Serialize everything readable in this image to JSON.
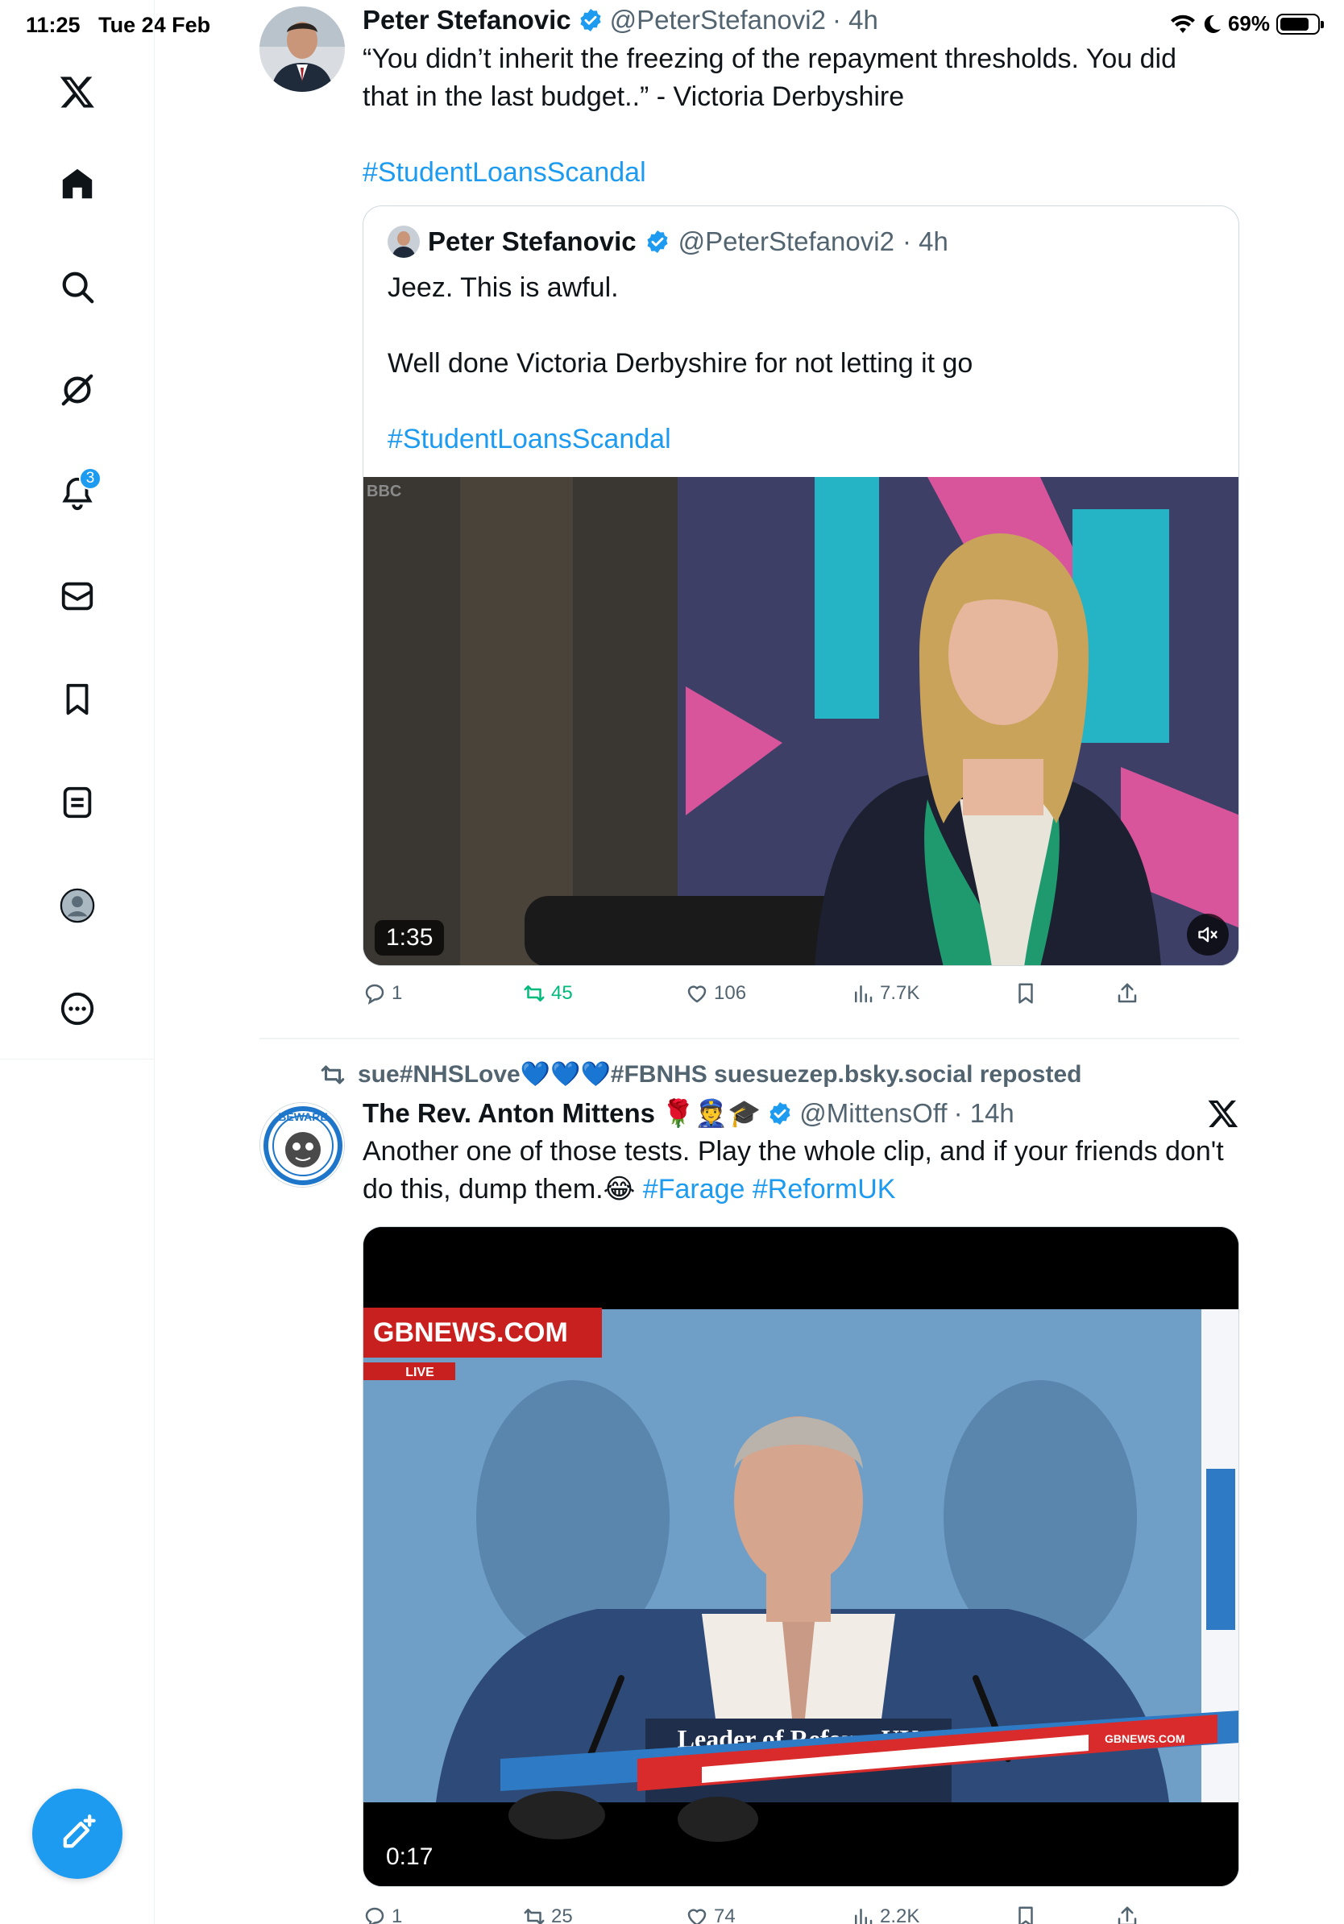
{
  "status_bar": {
    "time": "11:25",
    "date": "Tue 24 Feb",
    "battery": "69%"
  },
  "sidebar": {
    "items": [
      {
        "icon": "x-logo-icon"
      },
      {
        "icon": "home-icon"
      },
      {
        "icon": "search-icon"
      },
      {
        "icon": "grok-icon"
      },
      {
        "icon": "notifications-icon",
        "badge": "3"
      },
      {
        "icon": "messages-icon"
      },
      {
        "icon": "bookmarks-icon"
      },
      {
        "icon": "lists-icon"
      },
      {
        "icon": "profile-icon"
      },
      {
        "icon": "more-icon"
      }
    ],
    "compose_icon": "compose-icon"
  },
  "tweets": [
    {
      "display_name": "Peter Stefanovic",
      "handle": "@PeterStefanovi2",
      "time": "· 4h",
      "text_line1": "“You didn’t inherit the freezing of the repayment thresholds. You did",
      "text_line2": "that in the last budget..” - Victoria Derbyshire",
      "hashtag": "#StudentLoansScandal",
      "quote": {
        "display_name": "Peter Stefanovic",
        "handle": "@PeterStefanovi2",
        "time": "· 4h",
        "line1": "Jeez. This is awful.",
        "line2": "Well done Victoria Derbyshire for not letting it go",
        "hashtag": "#StudentLoansScandal",
        "video_duration": "1:35",
        "broadcaster_mark": "BBC"
      },
      "stats": {
        "replies": "1",
        "reposts": "45",
        "likes": "106",
        "views": "7.7K"
      }
    },
    {
      "repost_by": "sue#NHSLove💙💙💙#FBNHS suesuezep.bsky.social reposted",
      "display_name": "The Rev. Anton Mittens",
      "name_emojis": "🌹👮🎓",
      "handle": "@MittensOff",
      "time": "· 14h",
      "text_line1": "Another one of those tests. Play the whole clip, and if your friends don't",
      "text_line2_plain": "do this, dump them.😂",
      "hashtag1": "#Farage",
      "hashtag2": "#ReformUK",
      "video_duration": "0:17",
      "video_brand": "GBNEWS.COM",
      "video_live": "LIVE",
      "video_lectern": "Leader of Reform UK",
      "video_watermark": "GBNEWS.COM",
      "avatar_text": "BEWARE",
      "stats": {
        "replies": "1",
        "reposts": "25",
        "likes": "74",
        "views": "2.2K"
      }
    }
  ]
}
